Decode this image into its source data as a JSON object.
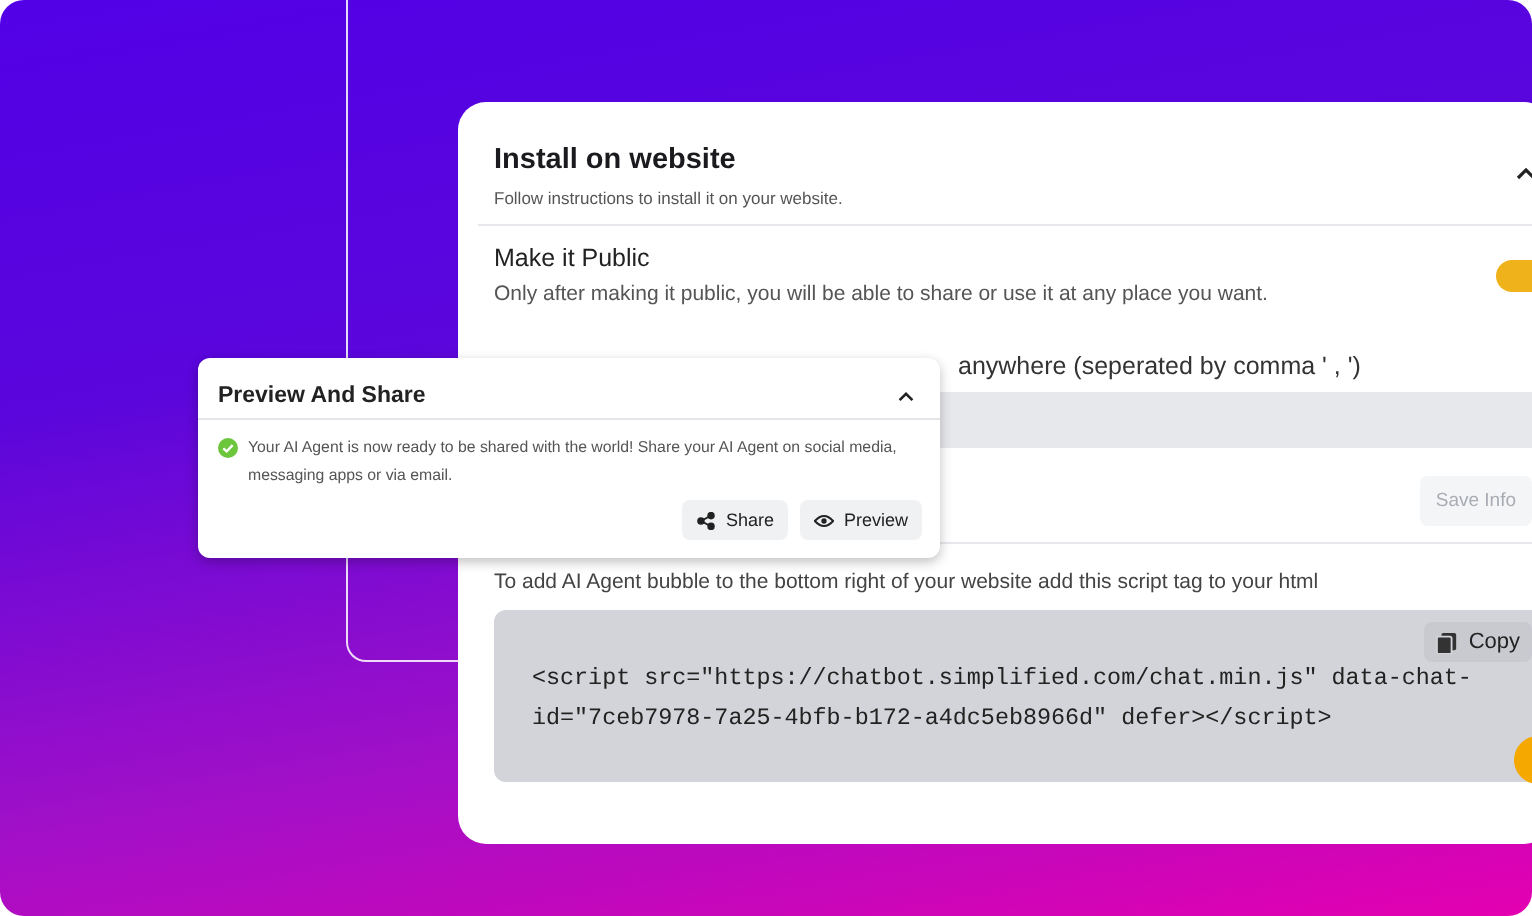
{
  "install": {
    "title": "Install on website",
    "subtitle": "Follow instructions to install it on your website.",
    "expanded": true,
    "public": {
      "label": "Make it Public",
      "description": "Only after making it public, you will be able to share or use it at any place you want.",
      "on": true
    },
    "domains": {
      "label": "anywhere (seperated by comma ' , ')"
    },
    "save_button": {
      "label": "Save Info",
      "disabled": true
    },
    "script": {
      "label": "To add AI Agent bubble to the bottom right of your website add this script tag to your html",
      "code": "<script src=\"https://chatbot.simplified.com/chat.min.js\" data-chat-id=\"7ceb7978-7a25-4bfb-b172-a4dc5eb8966d\" defer></script>",
      "copy": "Copy"
    }
  },
  "popup": {
    "title": "Preview And Share",
    "expanded": true,
    "message": "Your AI Agent is now ready to be shared with the world! Share your AI Agent on social media, messaging apps or via email.",
    "buttons": [
      {
        "kind": "share",
        "label": "Share"
      },
      {
        "kind": "preview",
        "label": "Preview"
      }
    ]
  }
}
